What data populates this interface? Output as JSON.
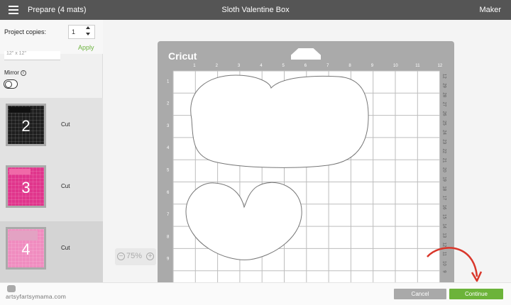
{
  "header": {
    "left_title": "Prepare (4 mats)",
    "center_title": "Sloth Valentine Box",
    "right_title": "Maker"
  },
  "sidebar": {
    "copies_label": "Project copies:",
    "copies_value": "1",
    "apply_label": "Apply",
    "hidden_field_text": "12\" x 12\"",
    "mirror_label": "Mirror",
    "mats": [
      {
        "number": "2",
        "label": "Cut",
        "color": "#1e1e1e"
      },
      {
        "number": "3",
        "label": "Cut",
        "color": "#e0358c"
      },
      {
        "number": "4",
        "label": "Cut",
        "color": "#f08cbf"
      }
    ]
  },
  "canvas": {
    "brand": "Cricut",
    "top_ruler": [
      "1",
      "2",
      "3",
      "4",
      "5",
      "6",
      "7",
      "8",
      "9",
      "10",
      "11",
      "12"
    ],
    "left_ruler": [
      "1",
      "2",
      "3",
      "4",
      "5",
      "6",
      "7",
      "8",
      "9"
    ],
    "right_ruler": [
      "12",
      "29",
      "28",
      "27",
      "26",
      "25",
      "24",
      "23",
      "22",
      "21",
      "20",
      "19",
      "18",
      "17",
      "16",
      "15",
      "14",
      "13",
      "12",
      "11",
      "10",
      "9",
      "8"
    ],
    "zoom": "75%"
  },
  "footer": {
    "watermark": "artsyfartsymama.com",
    "cancel_label": "Cancel",
    "continue_label": "Continue"
  },
  "colors": {
    "accent": "#6cb33a",
    "header_bg": "#555555",
    "mat_gray": "#aaaaaa",
    "arrow": "#d9372b"
  }
}
